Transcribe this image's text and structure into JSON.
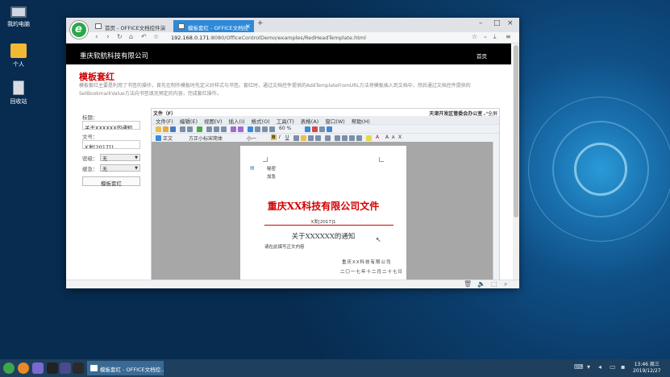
{
  "desktop": {
    "icons": [
      {
        "label": "我的电脑"
      },
      {
        "label": "个人"
      },
      {
        "label": "回收站"
      }
    ]
  },
  "browser": {
    "tabs": [
      {
        "label": "首页 - OFFICE文档控件演"
      },
      {
        "label": "模板套红 - OFFICE文档控"
      }
    ],
    "url_host": "192.168.0.171",
    "url_path": ":8080/OfficeControlDemo/examples/RedHeadTemplate.html"
  },
  "page": {
    "brand": "重庆软航科技有限公司",
    "home_link": "首页",
    "title": "模板套红",
    "description": "模板套红主要是利用了书签的操作，首先在制作模板时先定义好样式与书签。套红时，通过文档控件提供的AddTemplateFromURL方法将模板插入到文档中，然后通过文档控件提供的SetBookmarkValue方法向书签填充预定的内容，完成套红操作。",
    "form": {
      "title_label": "标题：",
      "title_value": "关于XXXXXX的通知",
      "docno_label": "文号：",
      "docno_value": "X发[2017]1",
      "secret_label": "密级：",
      "secret_value": "无",
      "urgency_label": "缓急：",
      "urgency_value": "无",
      "button_label": "模板套红"
    }
  },
  "office": {
    "file_label": "文件（F）",
    "right_label": "天津开发区管委会办公室",
    "fullscreen_label": "全屏",
    "menus": [
      "文件(F)",
      "编辑(E)",
      "视图(V)",
      "插入(I)",
      "格式(O)",
      "工具(T)",
      "表格(A)",
      "窗口(W)",
      "帮助(H)"
    ],
    "zoom": "60 %",
    "style_value": "正文",
    "font_value": "方正小标宋简体",
    "size_value": "小一",
    "document": {
      "meta_secret": "秘密",
      "meta_urgent": "加急",
      "red_title": "重庆XX科技有限公司文件",
      "doc_no": "X发[2017]1",
      "subject": "关于XXXXXX的通知",
      "recipient": "请在此填写正文内容",
      "signature": "重庆XX科技有限公司",
      "date": "二〇一七年十二月二十七日"
    }
  },
  "taskbar": {
    "window_label": "模板套红 - OFFICE文档控...",
    "time": "13:46 周三",
    "date": "2019/12/27"
  },
  "colors": {
    "accent": "#2e89d8",
    "title_red": "#cc0000",
    "nav_black": "#000000"
  }
}
